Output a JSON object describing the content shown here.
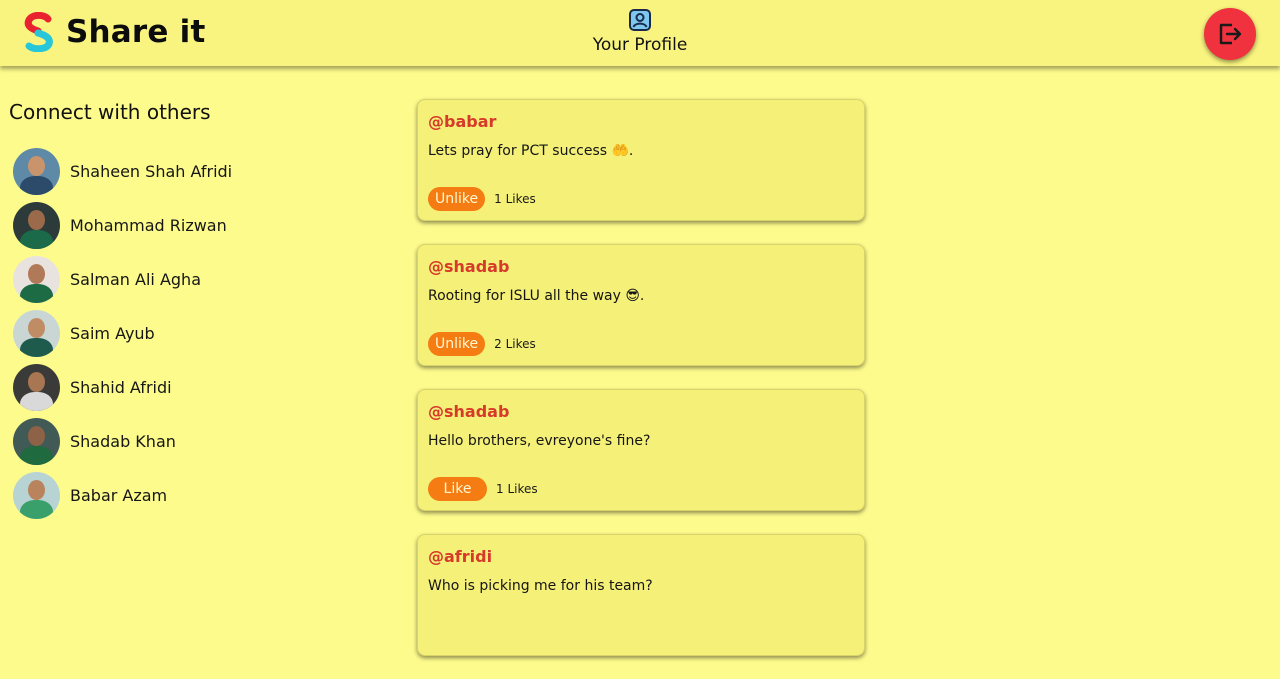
{
  "header": {
    "app_name": "Share it",
    "profile_label": "Your Profile",
    "colors": {
      "logo_red": "#e8232f",
      "logo_cyan": "#27c6d8",
      "logout_bg": "#f0323e"
    }
  },
  "sidebar": {
    "title": "Connect with others",
    "users": [
      {
        "name": "Shaheen Shah Afridi"
      },
      {
        "name": "Mohammad Rizwan"
      },
      {
        "name": "Salman Ali Agha"
      },
      {
        "name": "Saim Ayub"
      },
      {
        "name": "Shahid Afridi"
      },
      {
        "name": "Shadab Khan"
      },
      {
        "name": "Babar Azam"
      }
    ]
  },
  "feed": {
    "posts": [
      {
        "author": "@babar",
        "text": "Lets pray for PCT success 🤲.",
        "button": "Unlike",
        "likes": "1 Likes"
      },
      {
        "author": "@shadab",
        "text": "Rooting for ISLU all the way 😎.",
        "button": "Unlike",
        "likes": "2 Likes"
      },
      {
        "author": "@shadab",
        "text": "Hello brothers, evreyone's fine?",
        "button": "Like",
        "likes": "1 Likes"
      },
      {
        "author": "@afridi",
        "text": "Who is picking me for his team?",
        "button": "",
        "likes": ""
      }
    ]
  },
  "colors": {
    "page_bg": "#fdfb8c",
    "topbar_bg": "#f9f47f",
    "card_bg": "#f5f078",
    "author": "#d63a2a",
    "like_button": "#f47c12"
  }
}
